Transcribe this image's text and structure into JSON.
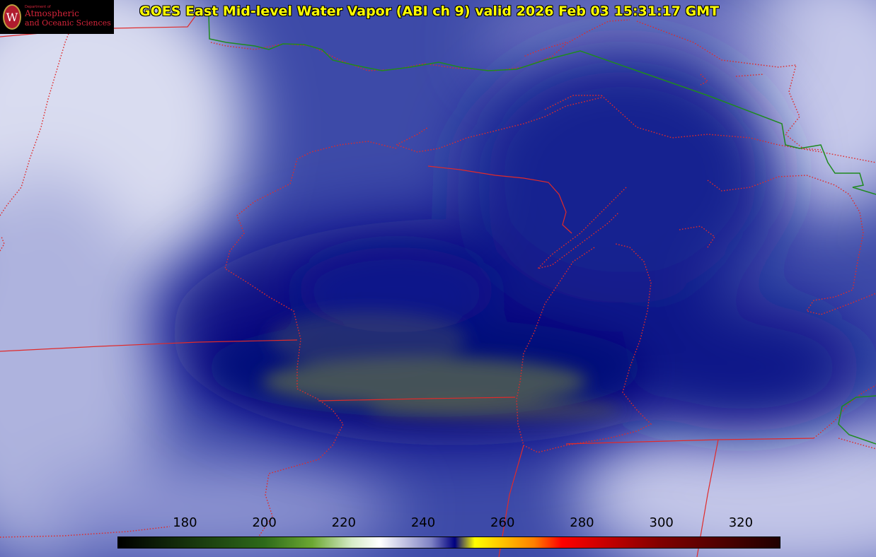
{
  "title": "GOES East Mid-level Water Vapor (ABI ch 9)  valid 2026 Feb 03 15:31:17 GMT",
  "logo": {
    "dept": "Department of",
    "line1": "Atmospheric",
    "line2": "and Oceanic Sciences",
    "seal_letter": "W",
    "color": "#d4243a"
  },
  "colorbar": {
    "min": 163,
    "max": 330,
    "ticks": [
      "180",
      "200",
      "220",
      "240",
      "260",
      "280",
      "300",
      "320"
    ],
    "stops": [
      {
        "value": 163,
        "color": "#000000"
      },
      {
        "value": 200,
        "color": "#2e6a1a"
      },
      {
        "value": 212,
        "color": "#6ca832"
      },
      {
        "value": 222,
        "color": "#d6ebc8"
      },
      {
        "value": 229,
        "color": "#ffffff"
      },
      {
        "value": 242,
        "color": "#7f82c4"
      },
      {
        "value": 248,
        "color": "#000080"
      },
      {
        "value": 253,
        "color": "#ffff00"
      },
      {
        "value": 268,
        "color": "#ff7f00"
      },
      {
        "value": 275,
        "color": "#ff0000"
      },
      {
        "value": 300,
        "color": "#800000"
      },
      {
        "value": 330,
        "color": "#200000"
      }
    ]
  },
  "colors": {
    "state_border": "#e02a2a",
    "country_border": "#1f8a1f",
    "dry_core": "#0a0f80",
    "moist": "#d8dcf0",
    "title": "#ffff00"
  }
}
